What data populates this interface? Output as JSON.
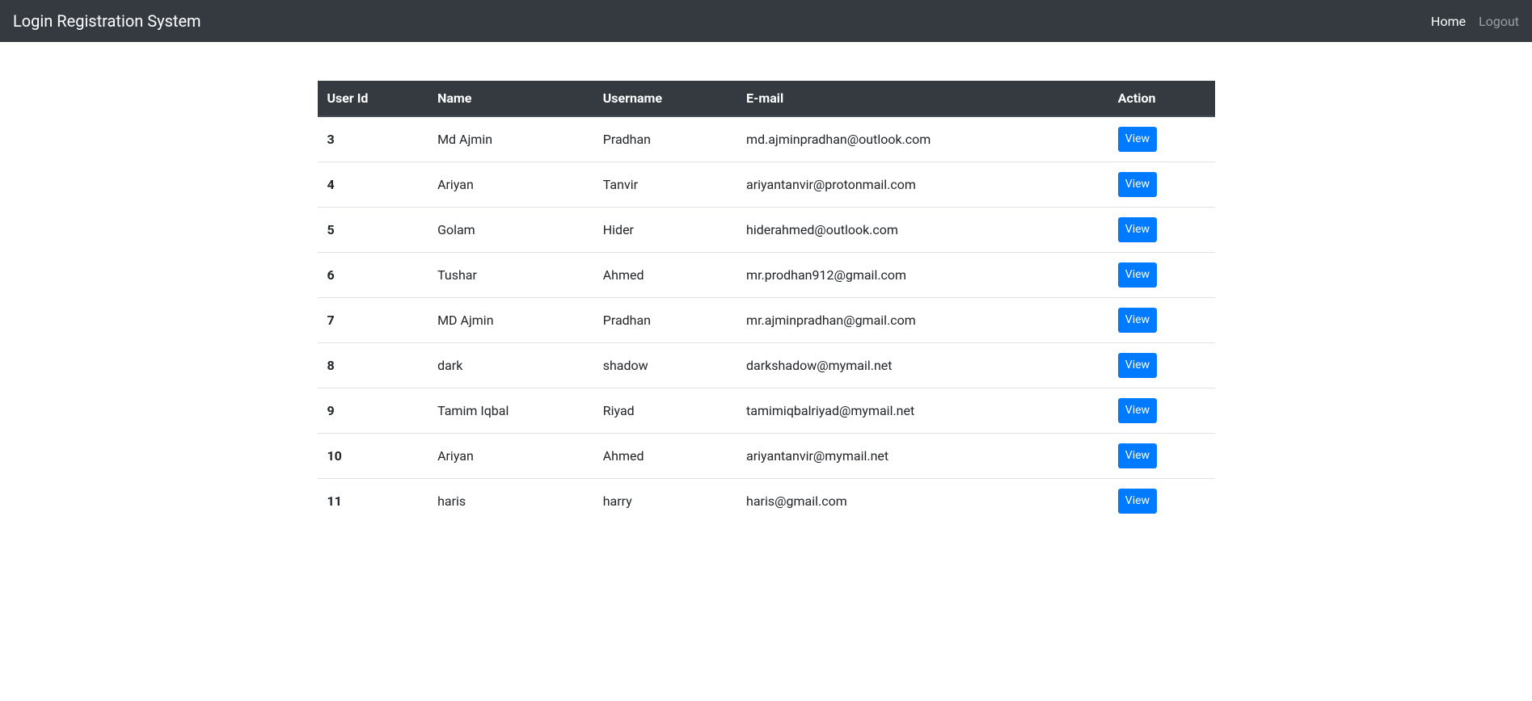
{
  "navbar": {
    "brand": "Login Registration System",
    "home_label": "Home",
    "logout_label": "Logout"
  },
  "table": {
    "headers": {
      "user_id": "User Id",
      "name": "Name",
      "username": "Username",
      "email": "E-mail",
      "action": "Action"
    },
    "rows": [
      {
        "user_id": "3",
        "name": "Md Ajmin",
        "username": "Pradhan",
        "email": "md.ajminpradhan@outlook.com"
      },
      {
        "user_id": "4",
        "name": "Ariyan",
        "username": "Tanvir",
        "email": "ariyantanvir@protonmail.com"
      },
      {
        "user_id": "5",
        "name": "Golam",
        "username": "Hider",
        "email": "hiderahmed@outlook.com"
      },
      {
        "user_id": "6",
        "name": "Tushar",
        "username": "Ahmed",
        "email": "mr.prodhan912@gmail.com"
      },
      {
        "user_id": "7",
        "name": "MD Ajmin",
        "username": "Pradhan",
        "email": "mr.ajminpradhan@gmail.com"
      },
      {
        "user_id": "8",
        "name": "dark",
        "username": "shadow",
        "email": "darkshadow@mymail.net"
      },
      {
        "user_id": "9",
        "name": "Tamim Iqbal",
        "username": "Riyad",
        "email": "tamimiqbalriyad@mymail.net"
      },
      {
        "user_id": "10",
        "name": "Ariyan",
        "username": "Ahmed",
        "email": "ariyantanvir@mymail.net"
      },
      {
        "user_id": "11",
        "name": "haris",
        "username": "harry",
        "email": "haris@gmail.com"
      }
    ],
    "action_label": "View"
  }
}
